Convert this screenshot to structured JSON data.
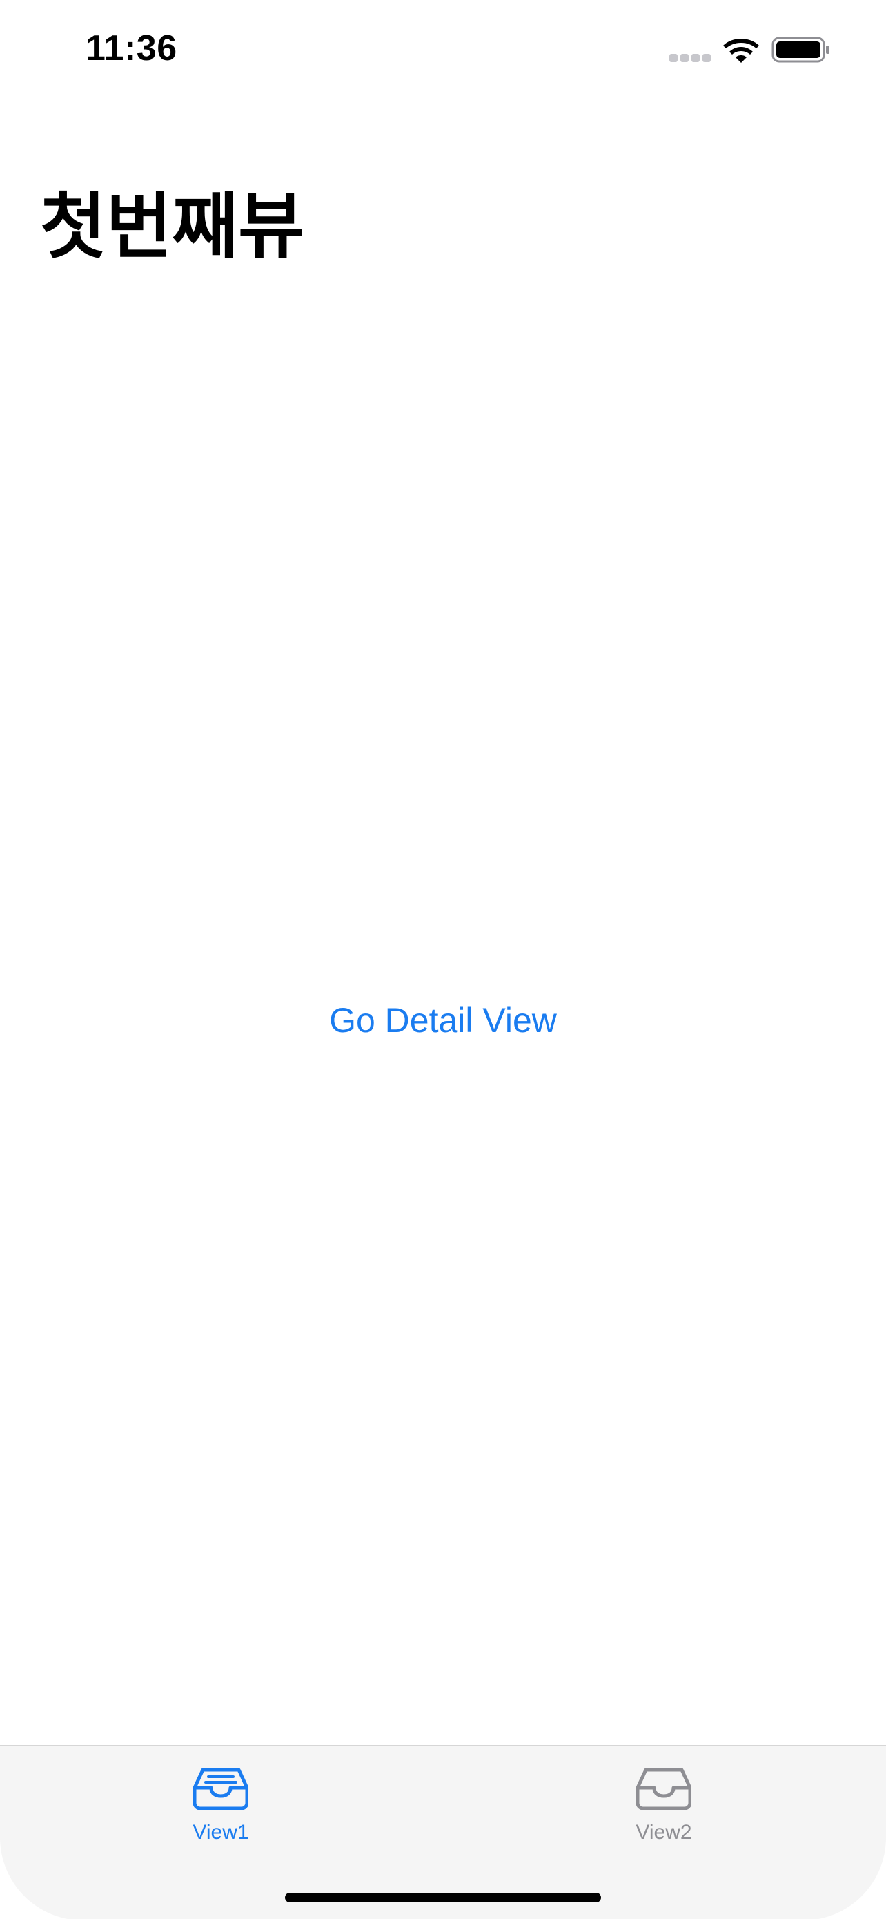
{
  "status_bar": {
    "time": "11:36"
  },
  "page": {
    "title": "첫번째뷰"
  },
  "content": {
    "detail_link_label": "Go Detail View"
  },
  "tab_bar": {
    "items": [
      {
        "label": "View1",
        "icon": "tray-icon",
        "selected": true
      },
      {
        "label": "View2",
        "icon": "tray-icon",
        "selected": false
      }
    ]
  },
  "colors": {
    "accent": "#1a7cf0",
    "inactive": "#8e8e93",
    "tab_bar_bg": "#f5f5f5"
  }
}
